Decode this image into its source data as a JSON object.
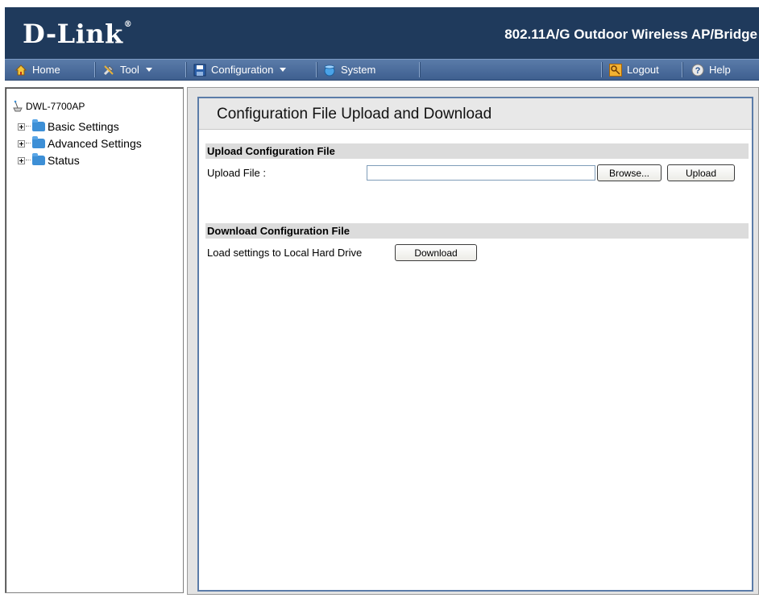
{
  "header": {
    "logo_text": "D-Link",
    "logo_mark": "®",
    "product_title": "802.11A/G Outdoor Wireless AP/Bridge"
  },
  "menubar": {
    "home": "Home",
    "tool": "Tool",
    "configuration": "Configuration",
    "system": "System",
    "logout": "Logout",
    "help": "Help"
  },
  "tree": {
    "root": "DWL-7700AP",
    "items": [
      {
        "label": "Basic Settings"
      },
      {
        "label": "Advanced Settings"
      },
      {
        "label": "Status"
      }
    ]
  },
  "page": {
    "title": "Configuration File Upload and Download",
    "upload": {
      "section_title": "Upload Configuration File",
      "file_label": "Upload File :",
      "file_value": "",
      "browse_label": "Browse...",
      "upload_label": "Upload"
    },
    "download": {
      "section_title": "Download Configuration File",
      "load_label": "Load settings to Local Hard Drive",
      "download_label": "Download"
    }
  },
  "colors": {
    "header_bg": "#1f3a5c",
    "menubar": "#4a6c9d",
    "frame_border": "#5b7ca8"
  }
}
